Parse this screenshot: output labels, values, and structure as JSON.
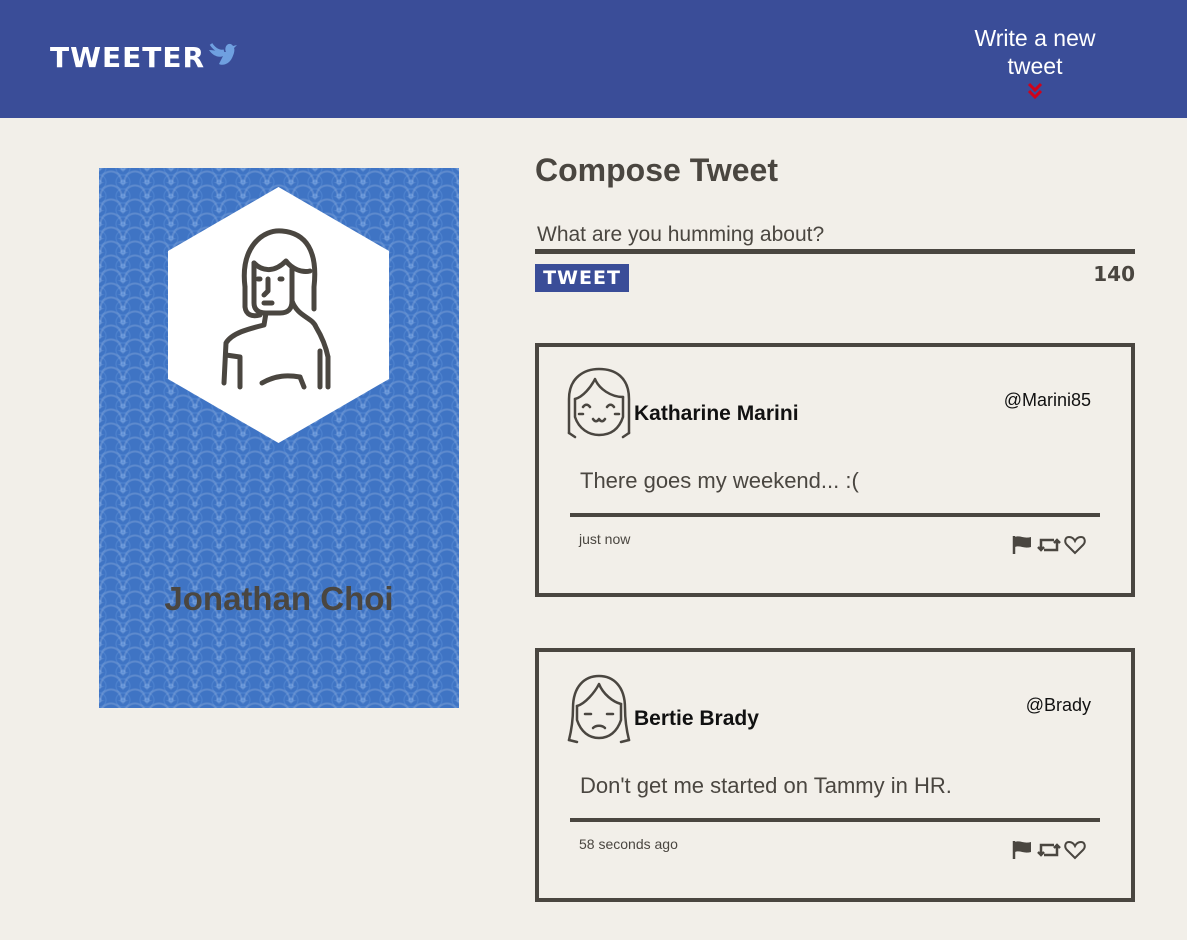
{
  "nav": {
    "logo_text": "TWEETER",
    "logo_icon": "bird-icon",
    "compose_label": "Write a new tweet",
    "compose_arrow_icon": "double-chevron-down-icon",
    "background_color": "#3a4d98",
    "arrow_color": "#d0021b"
  },
  "profile": {
    "name": "Jonathan Choi",
    "avatar_icon": "user-avatar-icon"
  },
  "compose": {
    "title": "Compose Tweet",
    "placeholder": "What are you humming about?",
    "button_label": "TWEET",
    "counter": "140"
  },
  "tweets": [
    {
      "name": "Katharine Marini",
      "handle": "@Marini85",
      "content": "There goes my weekend... :(",
      "time": "just now",
      "avatar_icon": "smiling-woman-avatar-icon",
      "actions": [
        "flag-icon",
        "retweet-icon",
        "heart-icon"
      ]
    },
    {
      "name": "Bertie Brady",
      "handle": "@Brady",
      "content": "Don't get me started on Tammy in HR.",
      "time": "58 seconds ago",
      "avatar_icon": "frowning-woman-avatar-icon",
      "actions": [
        "flag-icon",
        "retweet-icon",
        "heart-icon"
      ]
    }
  ]
}
